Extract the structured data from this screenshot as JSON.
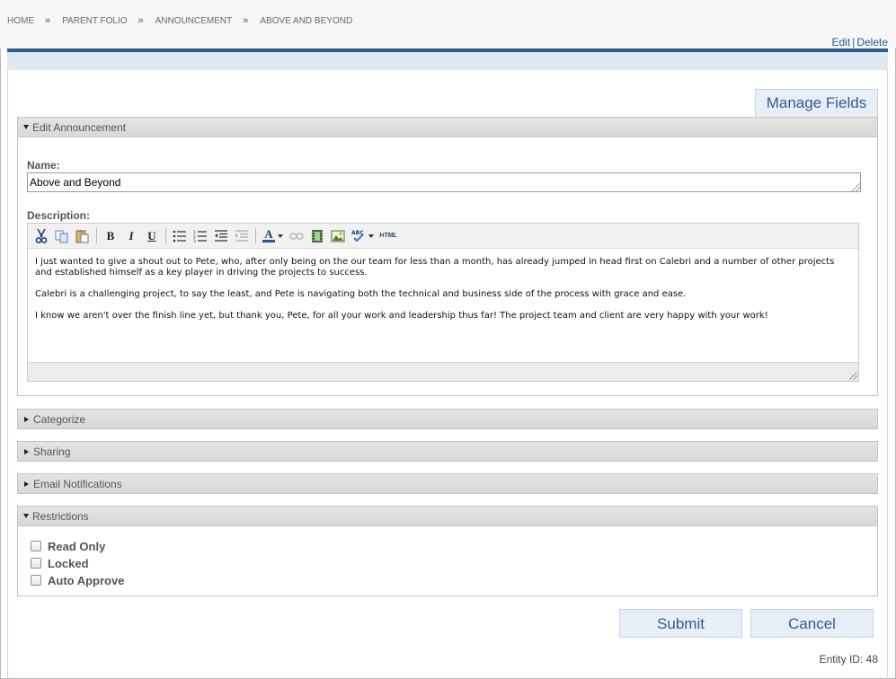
{
  "breadcrumb": {
    "items": [
      "HOME",
      "PARENT FOLIO",
      "ANNOUNCEMENT",
      "ABOVE AND BEYOND"
    ],
    "separator": "»"
  },
  "top_links": {
    "edit": "Edit",
    "pipe": "|",
    "delete": "Delete"
  },
  "manage_fields": "Manage Fields",
  "edit_section": {
    "title": "Edit Announcement",
    "name_label": "Name:",
    "name_value": "Above and Beyond",
    "description_label": "Description:",
    "toolbar": {
      "bold": "B",
      "italic": "I",
      "underline": "U",
      "text_color": "A",
      "html": "HTML"
    },
    "description_paragraphs": [
      "I just wanted to give a shout out to Pete, who, after only being on the our team for less than a month, has already jumped in head first on Calebri and a number of other projects and established himself as a key player in driving the projects to success.",
      "Calebri is a challenging project, to say the least, and Pete is navigating both the technical and business side of the process with grace and ease.",
      "I know we aren't over the finish line yet, but thank you, Pete, for all your work and leadership thus far! The project team and client are very happy with your work!"
    ]
  },
  "collapsed_sections": [
    "Categorize",
    "Sharing",
    "Email Notifications"
  ],
  "restrictions": {
    "title": "Restrictions",
    "options": [
      "Read Only",
      "Locked",
      "Auto Approve"
    ]
  },
  "buttons": {
    "submit": "Submit",
    "cancel": "Cancel"
  },
  "entity_id": "Entity ID: 48",
  "colors": {
    "brand_blue": "#335b91",
    "link_blue": "#2c5a8f",
    "light_blue": "#dde9f3"
  }
}
